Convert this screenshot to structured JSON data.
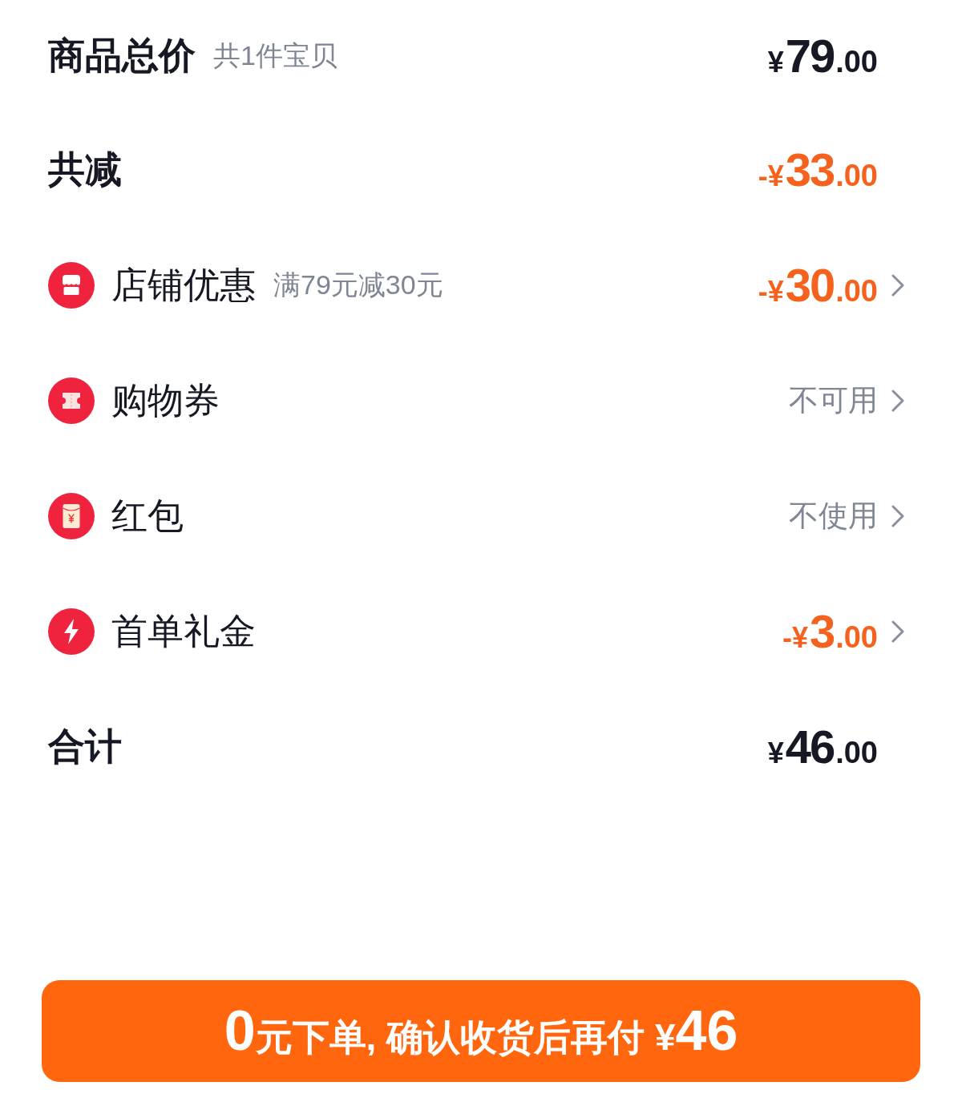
{
  "summary": [
    {
      "label": "商品总价",
      "note": "共1件宝贝",
      "amount": {
        "kind": "price",
        "prefix": "¥",
        "integer": "79",
        "decimal": ".00"
      }
    },
    {
      "label": "共减",
      "amount": {
        "kind": "deduction",
        "prefix": "-¥",
        "integer": "33",
        "decimal": ".00"
      }
    }
  ],
  "discounts": [
    {
      "kind": "shop",
      "label": "店铺优惠",
      "note": "满79元减30元",
      "amount": {
        "kind": "deduction",
        "prefix": "-¥",
        "integer": "30",
        "decimal": ".00"
      }
    },
    {
      "kind": "coupon",
      "label": "购物券",
      "value": "不可用"
    },
    {
      "kind": "packet",
      "label": "红包",
      "value": "不使用"
    },
    {
      "kind": "bonus",
      "label": "首单礼金",
      "amount": {
        "kind": "deduction",
        "prefix": "-¥",
        "integer": "3",
        "decimal": ".00"
      }
    }
  ],
  "total": {
    "label": "合计",
    "amount": {
      "kind": "price",
      "prefix": "¥",
      "integer": "46",
      "decimal": ".00"
    }
  },
  "submit_button": {
    "parts": [
      {
        "kind": "big",
        "text": "0"
      },
      {
        "kind": "small",
        "text": "元下单, 确认收货后再付"
      },
      {
        "kind": "small",
        "text": " ¥"
      },
      {
        "kind": "big",
        "text": "46"
      }
    ]
  }
}
